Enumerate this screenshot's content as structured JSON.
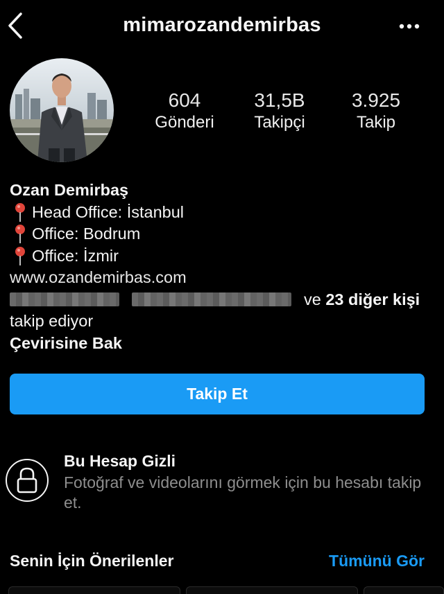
{
  "header": {
    "username": "mimarozandemirbas"
  },
  "stats": [
    {
      "value": "604",
      "label": "Gönderi"
    },
    {
      "value": "31,5B",
      "label": "Takipçi"
    },
    {
      "value": "3.925",
      "label": "Takip"
    }
  ],
  "bio": {
    "name": "Ozan Demirbaş",
    "lines": [
      "Head Office: İstanbul",
      "Office: Bodrum",
      "Office: İzmir"
    ],
    "website": "www.ozandemirbas.com",
    "followed_by_prefix": "ve",
    "followed_by_count": "23 diğer kişi",
    "followed_by_suffix": "takip ediyor",
    "translate": "Çevirisine Bak"
  },
  "follow_button": "Takip Et",
  "private_notice": {
    "title": "Bu Hesap Gizli",
    "description": "Fotoğraf ve videolarını görmek için bu hesabı takip et."
  },
  "suggestions": {
    "title": "Senin İçin Önerilenler",
    "see_all": "Tümünü Gör"
  },
  "colors": {
    "background": "#000000",
    "accent": "#1a9bf5",
    "secondary_text": "#8e8e8e",
    "pin": "#e0453a"
  }
}
